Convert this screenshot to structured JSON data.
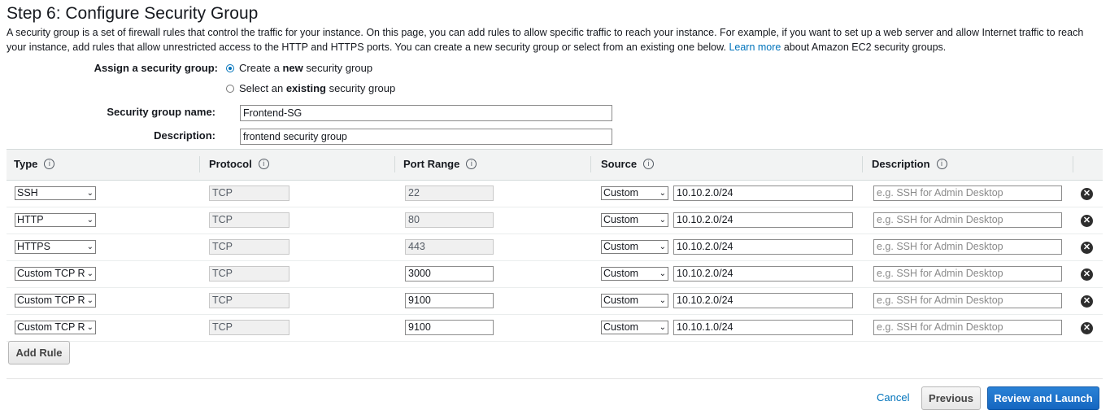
{
  "step_title": "Step 6: Configure Security Group",
  "intro": {
    "text_before_link": "A security group is a set of firewall rules that control the traffic for your instance. On this page, you can add rules to allow specific traffic to reach your instance. For example, if you want to set up a web server and allow Internet traffic to reach your instance, add rules that allow unrestricted access to the HTTP and HTTPS ports. You can create a new security group or select from an existing one below.",
    "link": "Learn more",
    "text_after_link": "about Amazon EC2 security groups."
  },
  "assign": {
    "label": "Assign a security group:",
    "option_new_pre": "Create a ",
    "option_new_bold": "new",
    "option_new_post": " security group",
    "option_existing_pre": "Select an ",
    "option_existing_bold": "existing",
    "option_existing_post": " security group",
    "selected": "new"
  },
  "sg_name": {
    "label": "Security group name:",
    "value": "Frontend-SG"
  },
  "sg_description": {
    "label": "Description:",
    "value": "frontend security group"
  },
  "table": {
    "headers": {
      "type": "Type",
      "protocol": "Protocol",
      "port_range": "Port Range",
      "source": "Source",
      "description": "Description"
    },
    "info_glyph": "i",
    "description_placeholder": "e.g. SSH for Admin Desktop",
    "delete_glyph": "✕",
    "rows": [
      {
        "type": "SSH",
        "protocol": "TCP",
        "port": "22",
        "port_editable": false,
        "source_type": "Custom",
        "source": "10.10.2.0/24"
      },
      {
        "type": "HTTP",
        "protocol": "TCP",
        "port": "80",
        "port_editable": false,
        "source_type": "Custom",
        "source": "10.10.2.0/24"
      },
      {
        "type": "HTTPS",
        "protocol": "TCP",
        "port": "443",
        "port_editable": false,
        "source_type": "Custom",
        "source": "10.10.2.0/24"
      },
      {
        "type": "Custom TCP R",
        "protocol": "TCP",
        "port": "3000",
        "port_editable": true,
        "source_type": "Custom",
        "source": "10.10.2.0/24"
      },
      {
        "type": "Custom TCP R",
        "protocol": "TCP",
        "port": "9100",
        "port_editable": true,
        "source_type": "Custom",
        "source": "10.10.2.0/24"
      },
      {
        "type": "Custom TCP R",
        "protocol": "TCP",
        "port": "9100",
        "port_editable": true,
        "source_type": "Custom",
        "source": "10.10.1.0/24"
      }
    ]
  },
  "buttons": {
    "add_rule": "Add Rule",
    "cancel": "Cancel",
    "previous": "Previous",
    "review_launch": "Review and Launch"
  },
  "colors": {
    "link": "#0073bb",
    "primary_button": "#1b6fc9",
    "header_bg": "#f2f3f3"
  }
}
